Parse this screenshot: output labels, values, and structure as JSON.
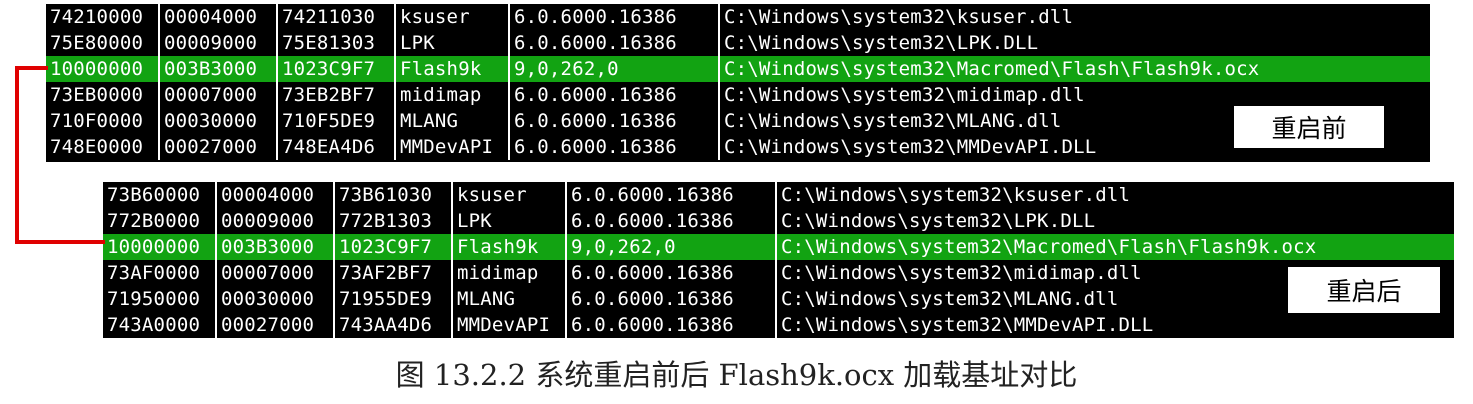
{
  "before": {
    "tag": "重启前",
    "rows": [
      {
        "base": "74210000",
        "size": "00004000",
        "entry": "74211030",
        "name": "ksuser",
        "version": "6.0.6000.16386",
        "path": "C:\\Windows\\system32\\ksuser.dll",
        "highlight": false
      },
      {
        "base": "75E80000",
        "size": "00009000",
        "entry": "75E81303",
        "name": "LPK",
        "version": "6.0.6000.16386",
        "path": "C:\\Windows\\system32\\LPK.DLL",
        "highlight": false
      },
      {
        "base": "10000000",
        "size": "003B3000",
        "entry": "1023C9F7",
        "name": "Flash9k",
        "version": "9,0,262,0",
        "path": "C:\\Windows\\system32\\Macromed\\Flash\\Flash9k.ocx",
        "highlight": true
      },
      {
        "base": "73EB0000",
        "size": "00007000",
        "entry": "73EB2BF7",
        "name": "midimap",
        "version": "6.0.6000.16386",
        "path": "C:\\Windows\\system32\\midimap.dll",
        "highlight": false
      },
      {
        "base": "710F0000",
        "size": "00030000",
        "entry": "710F5DE9",
        "name": "MLANG",
        "version": "6.0.6000.16386",
        "path": "C:\\Windows\\system32\\MLANG.dll",
        "highlight": false
      },
      {
        "base": "748E0000",
        "size": "00027000",
        "entry": "748EA4D6",
        "name": "MMDevAPI",
        "version": "6.0.6000.16386",
        "path": "C:\\Windows\\system32\\MMDevAPI.DLL",
        "highlight": false
      }
    ]
  },
  "after": {
    "tag": "重启后",
    "rows": [
      {
        "base": "73B60000",
        "size": "00004000",
        "entry": "73B61030",
        "name": "ksuser",
        "version": "6.0.6000.16386",
        "path": "C:\\Windows\\system32\\ksuser.dll",
        "highlight": false
      },
      {
        "base": "772B0000",
        "size": "00009000",
        "entry": "772B1303",
        "name": "LPK",
        "version": "6.0.6000.16386",
        "path": "C:\\Windows\\system32\\LPK.DLL",
        "highlight": false
      },
      {
        "base": "10000000",
        "size": "003B3000",
        "entry": "1023C9F7",
        "name": "Flash9k",
        "version": "9,0,262,0",
        "path": "C:\\Windows\\system32\\Macromed\\Flash\\Flash9k.ocx",
        "highlight": true
      },
      {
        "base": "73AF0000",
        "size": "00007000",
        "entry": "73AF2BF7",
        "name": "midimap",
        "version": "6.0.6000.16386",
        "path": "C:\\Windows\\system32\\midimap.dll",
        "highlight": false
      },
      {
        "base": "71950000",
        "size": "00030000",
        "entry": "71955DE9",
        "name": "MLANG",
        "version": "6.0.6000.16386",
        "path": "C:\\Windows\\system32\\MLANG.dll",
        "highlight": false
      },
      {
        "base": "743A0000",
        "size": "00027000",
        "entry": "743AA4D6",
        "name": "MMDevAPI",
        "version": "6.0.6000.16386",
        "path": "C:\\Windows\\system32\\MMDevAPI.DLL",
        "highlight": false
      }
    ]
  },
  "caption": "图 13.2.2    系统重启前后 Flash9k.ocx 加载基址对比",
  "colors": {
    "panel_bg": "#000000",
    "row_text": "#ffffff",
    "highlight_row": "#12a312",
    "connector": "#e00000",
    "tag_bg": "#ffffff"
  }
}
